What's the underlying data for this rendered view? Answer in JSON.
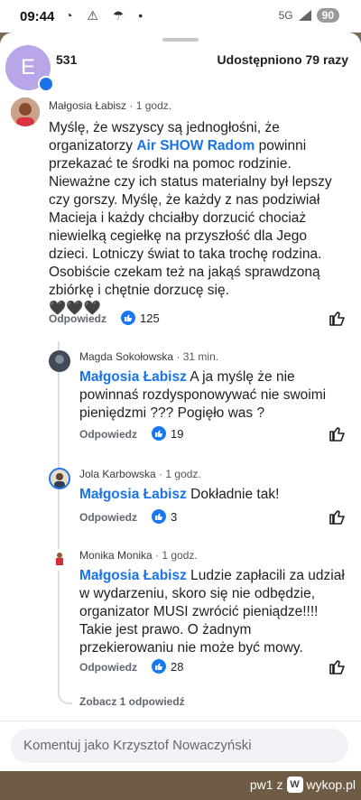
{
  "status_bar": {
    "time": "09:44",
    "icons": "◔ ⚠ ☂ •",
    "signal": "5G",
    "battery": "90"
  },
  "header": {
    "reactions_count": "531",
    "shares": "Udostępniono 79 razy",
    "avatar_letter": "E"
  },
  "comments": [
    {
      "author": "Małgosia Łabisz",
      "time": "1 godz.",
      "text_before": "Myślę, że wszyscy są jednogłośni, że organizatorzy ",
      "tag": "Air SHOW Radom",
      "text_after": " powinni przekazać te środki na pomoc rodzinie. Nieważne czy ich status materialny był lepszy czy gorszy. Myślę, że każdy z nas podziwiał Macieja i każdy chciałby dorzucić chociaż niewielką cegiełkę na przyszłość dla Jego dzieci. Lotniczy świat to taka trochę rodzina.",
      "text_line2": "Osobiście czekam też na jakąś sprawdzoną zbiórkę i chętnie dorzucę się.",
      "emoji": "🖤🖤🖤",
      "reply_label": "Odpowiedz",
      "likes": "125"
    },
    {
      "author": "Magda Sokołowska",
      "time": "31 min.",
      "tag": "Małgosia Łabisz",
      "text_after": " A ja myślę że nie powinnaś rozdysponowywać nie swoimi pieniędzmi ???  Pogięło was ?",
      "reply_label": "Odpowiedz",
      "likes": "19"
    },
    {
      "author": "Jola Karbowska",
      "time": "1 godz.",
      "tag": "Małgosia Łabisz",
      "text_after": " Dokładnie tak!",
      "reply_label": "Odpowiedz",
      "likes": "3"
    },
    {
      "author": "Monika Monika",
      "time": "1 godz.",
      "tag": "Małgosia Łabisz",
      "text_after": " Ludzie zapłacili za udział w wydarzeniu, skoro się nie odbędzie, organizator MUSI zwrócić pieniądze!!!! Takie jest prawo. O żadnym przekierowaniu nie może być mowy.",
      "reply_label": "Odpowiedz",
      "likes": "28"
    }
  ],
  "see_more_replies": "Zobacz 1 odpowiedź",
  "composer": {
    "placeholder": "Komentuj jako Krzysztof Nowaczyński"
  },
  "watermark": {
    "user": "pw1",
    "mid": "z",
    "site": "wykop.pl"
  },
  "colors": {
    "accent": "#1a73e8",
    "like_blue": "#1877f2"
  }
}
